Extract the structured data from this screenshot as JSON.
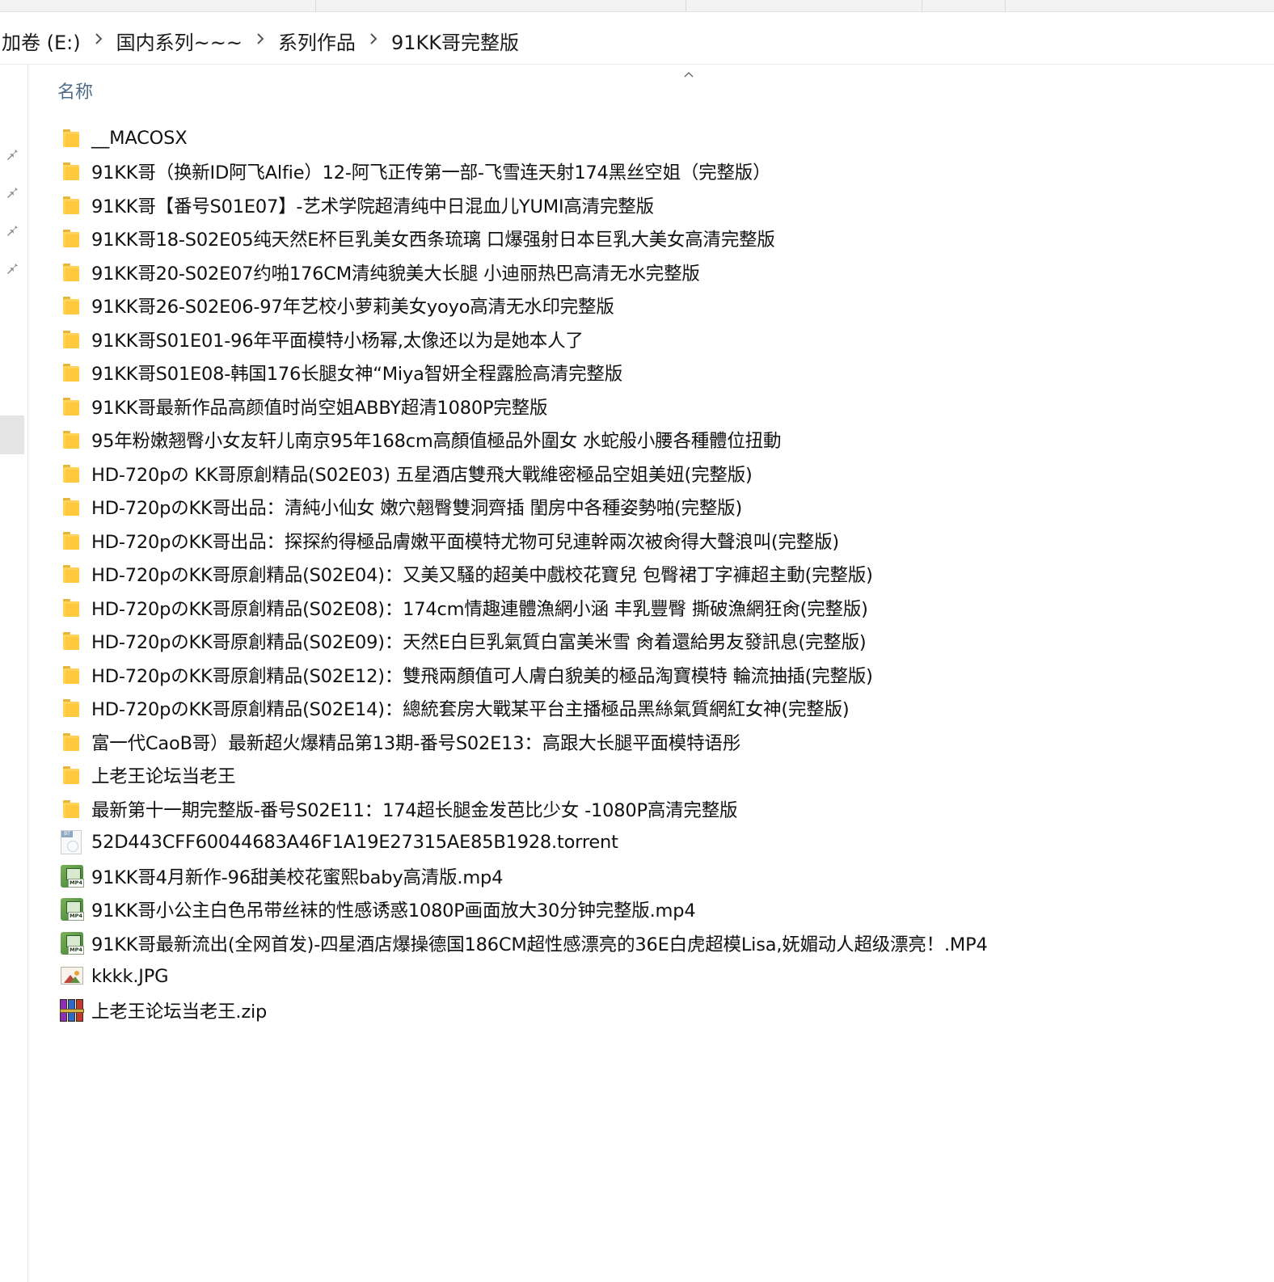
{
  "breadcrumb": [
    "加卷 (E:)",
    "国内系列~~~",
    "系列作品",
    "91KK哥完整版"
  ],
  "icons": {
    "chevron": "chevron-right-icon",
    "sort": "chevron-up-icon",
    "pin": "pin-icon"
  },
  "list": {
    "column_header": "名称",
    "items": [
      {
        "name": "__MACOSX",
        "type": "folder"
      },
      {
        "name": "91KK哥（换新ID阿飞Alfie）12-阿飞正传第一部-飞雪连天射174黑丝空姐（完整版）",
        "type": "folder"
      },
      {
        "name": "91KK哥【番号S01E07】-艺术学院超清纯中日混血儿YUMI高清完整版",
        "type": "folder"
      },
      {
        "name": "91KK哥18-S02E05纯天然E杯巨乳美女西条琉璃 口爆强射日本巨乳大美女高清完整版",
        "type": "folder"
      },
      {
        "name": "91KK哥20-S02E07约啪176CM清纯貌美大长腿 小迪丽热巴高清无水完整版",
        "type": "folder"
      },
      {
        "name": "91KK哥26-S02E06-97年艺校小萝莉美女yoyo高清无水印完整版",
        "type": "folder"
      },
      {
        "name": "91KK哥S01E01-96年平面模特小杨幂,太像还以为是她本人了",
        "type": "folder"
      },
      {
        "name": "91KK哥S01E08-韩国176长腿女神“Miya智妍全程露脸高清完整版",
        "type": "folder"
      },
      {
        "name": "91KK哥最新作品高颜值时尚空姐ABBY超清1080P完整版",
        "type": "folder"
      },
      {
        "name": "95年粉嫩翘臀小女友轩儿南京95年168cm高顏值極品外圍女 水蛇般小腰各種體位扭動",
        "type": "folder"
      },
      {
        "name": "HD-720pの KK哥原創精品(S02E03) 五星酒店雙飛大戰維密極品空姐美妞(完整版)",
        "type": "folder"
      },
      {
        "name": "HD-720pのKK哥出品：清純小仙女 嫩穴翹臀雙洞齊插 閨房中各種姿勢啪(完整版)",
        "type": "folder"
      },
      {
        "name": "HD-720pのKK哥出品：探探約得極品膚嫩平面模特尤物可兒連幹兩次被肏得大聲浪叫(完整版)",
        "type": "folder"
      },
      {
        "name": "HD-720pのKK哥原創精品(S02E04)：又美又騷的超美中戲校花寶兒 包臀裙丁字褲超主動(完整版)",
        "type": "folder"
      },
      {
        "name": "HD-720pのKK哥原創精品(S02E08)：174cm情趣連體漁網小涵 丰乳豐臀 撕破漁網狂肏(完整版)",
        "type": "folder"
      },
      {
        "name": "HD-720pのKK哥原創精品(S02E09)：天然E白巨乳氣質白富美米雪 肏着還給男友發訊息(完整版)",
        "type": "folder"
      },
      {
        "name": "HD-720pのKK哥原創精品(S02E12)：雙飛兩顏值可人膚白貌美的極品淘寶模特 輪流抽插(完整版)",
        "type": "folder"
      },
      {
        "name": "HD-720pのKK哥原創精品(S02E14)：總統套房大戰某平台主播極品黑絲氣質網紅女神(完整版)",
        "type": "folder"
      },
      {
        "name": "富一代CaoB哥）最新超火爆精品第13期-番号S02E13：高跟大长腿平面模特语彤",
        "type": "folder"
      },
      {
        "name": "上老王论坛当老王",
        "type": "folder"
      },
      {
        "name": "最新第十一期完整版-番号S02E11：174超长腿金发芭比少女 -1080P高清完整版",
        "type": "folder"
      },
      {
        "name": "52D443CFF60044683A46F1A19E27315AE85B1928.torrent",
        "type": "torrent"
      },
      {
        "name": "91KK哥4月新作-96甜美校花蜜熙baby高清版.mp4",
        "type": "mp4"
      },
      {
        "name": "91KK哥小公主白色吊带丝袜的性感诱惑1080P画面放大30分钟完整版.mp4",
        "type": "mp4"
      },
      {
        "name": "91KK哥最新流出(全网首发)-四星酒店爆操德国186CM超性感漂亮的36E白虎超模Lisa,妩媚动人超级漂亮！.MP4",
        "type": "mp4"
      },
      {
        "name": "kkkk.JPG",
        "type": "jpg"
      },
      {
        "name": "上老王论坛当老王.zip",
        "type": "zip"
      }
    ]
  },
  "file_icon_labels": {
    "torrent": "BT",
    "mp4": "MP4"
  },
  "colors": {
    "folder": "#ffc83d",
    "header_text": "#4f6d8a",
    "selection": "#e5e5e5"
  }
}
